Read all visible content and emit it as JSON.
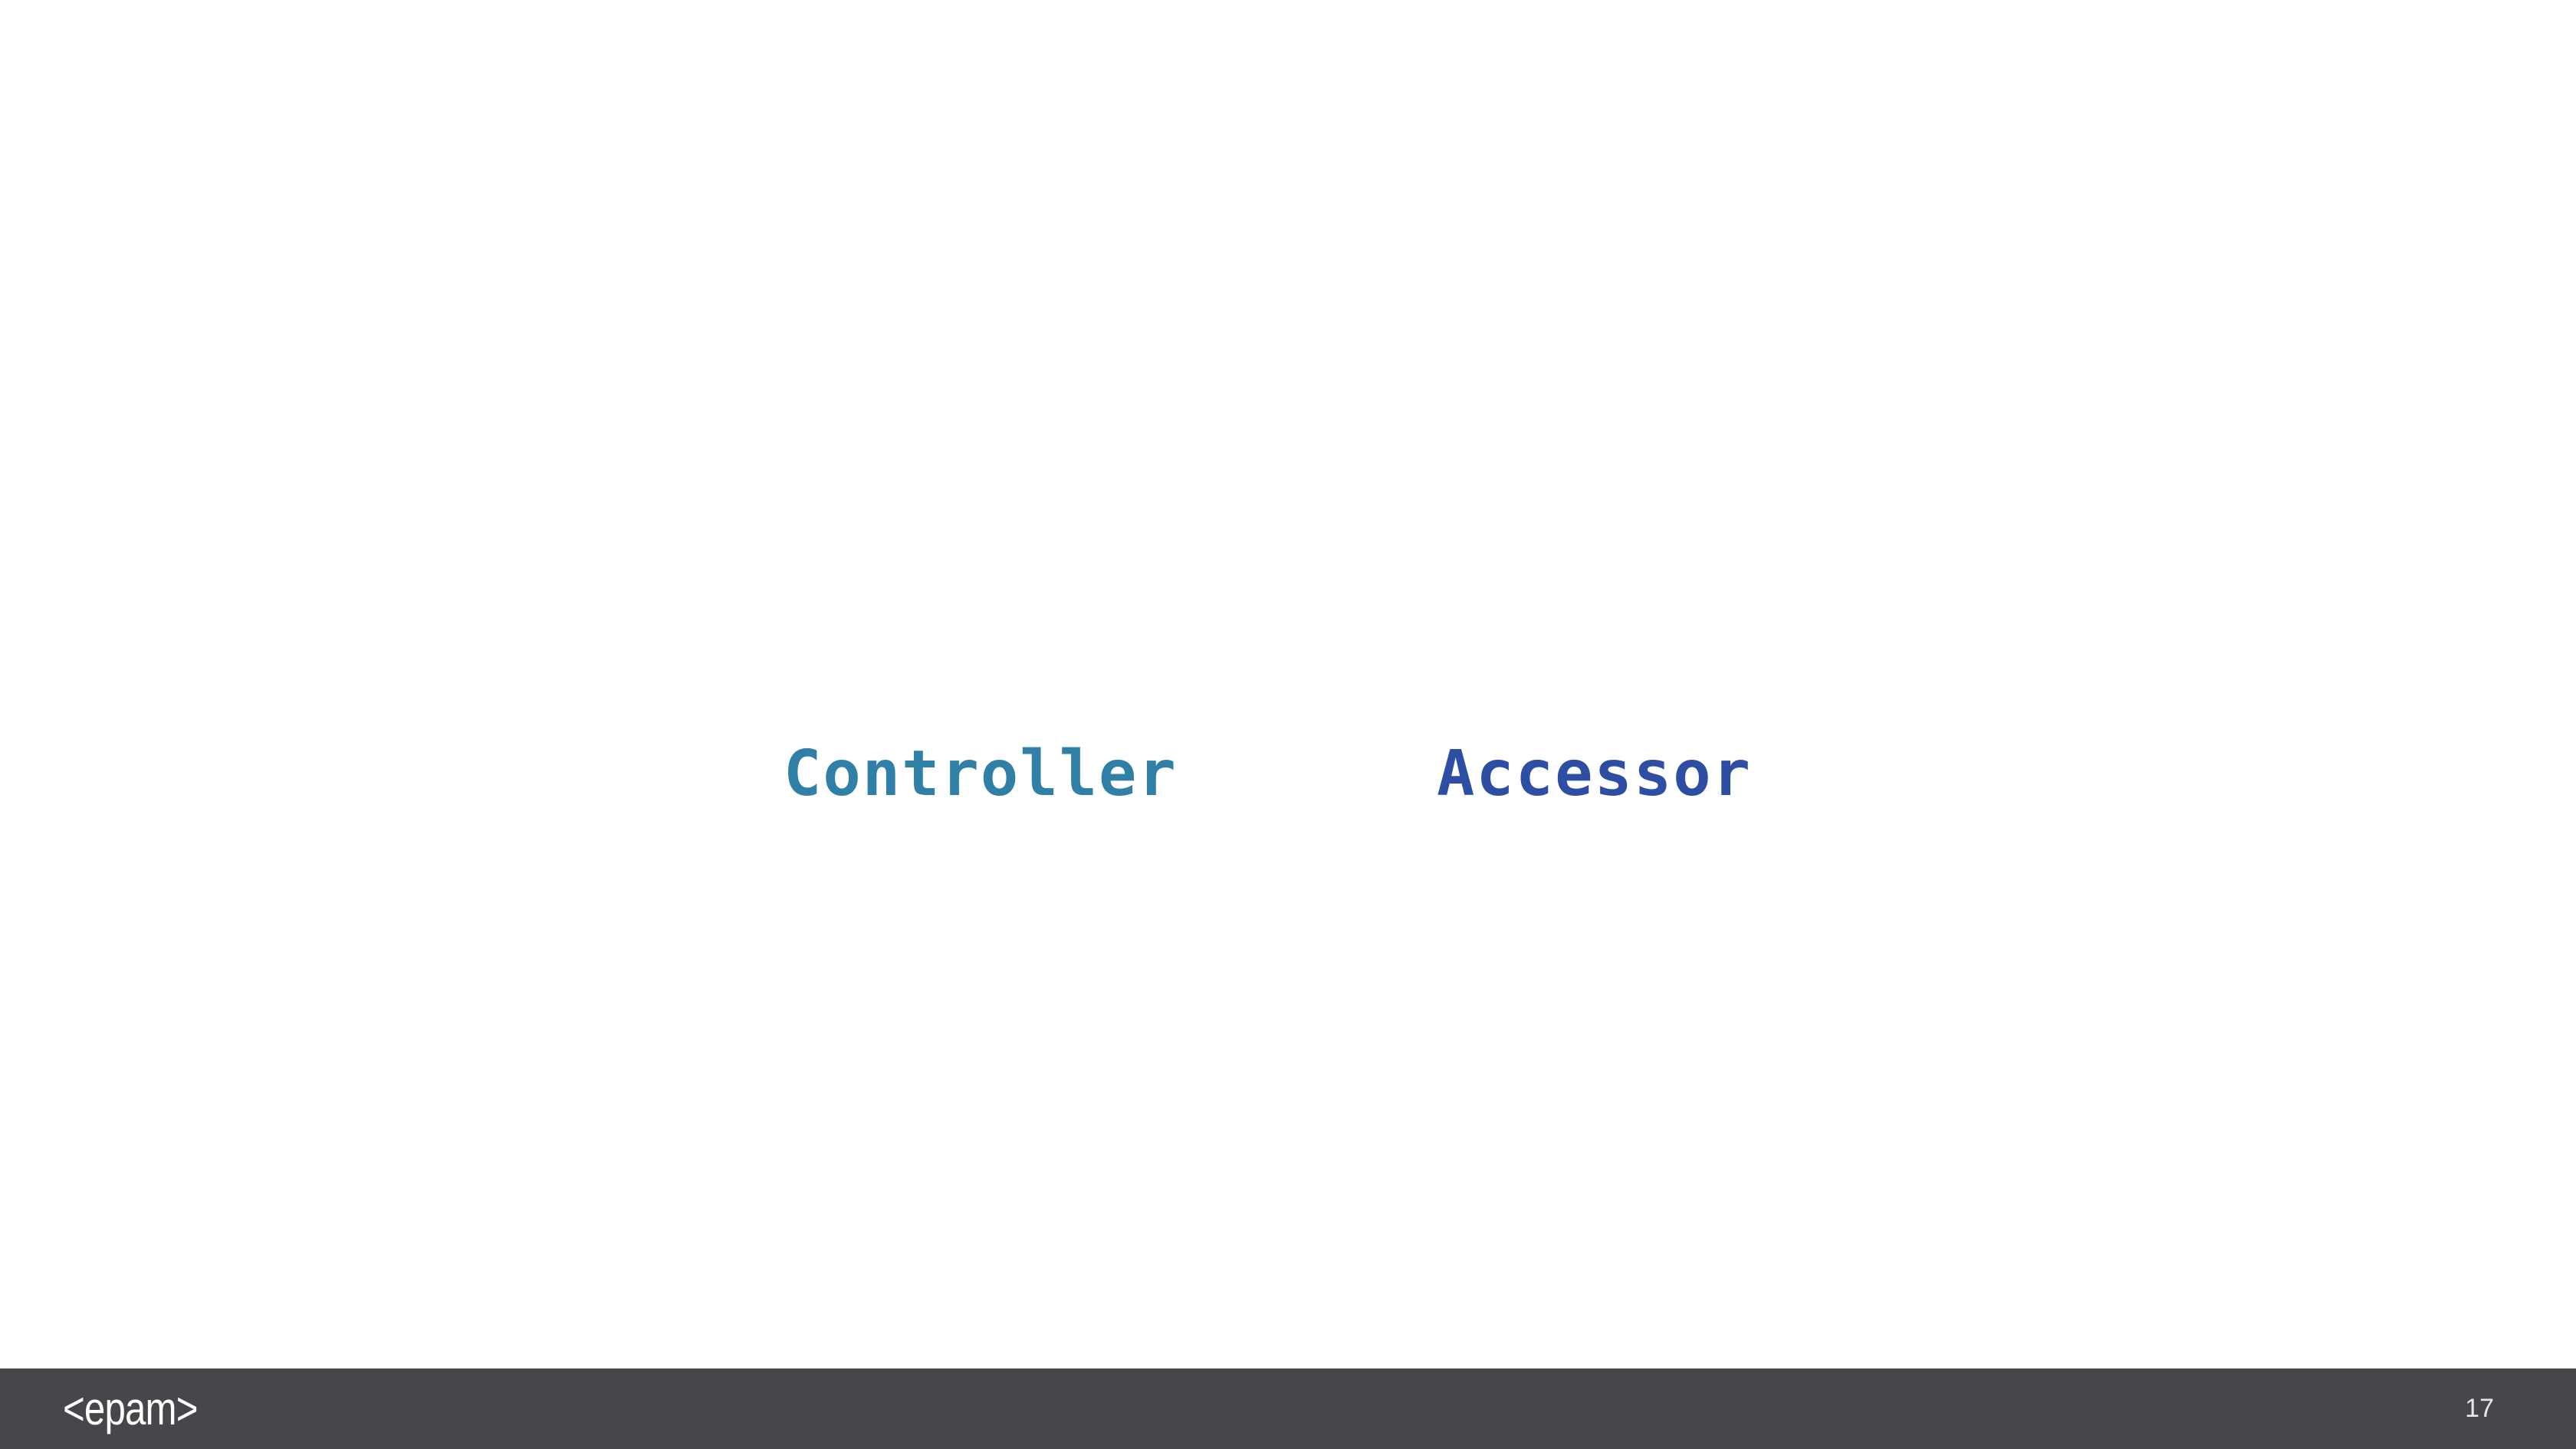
{
  "slide": {
    "words": [
      {
        "text": "Controller",
        "color": "#2f7fa6"
      },
      {
        "text": "Accessor",
        "color": "#2e4ea3"
      }
    ]
  },
  "footer": {
    "logo_text": "<epam>",
    "page_number": "17",
    "background_color": "#46474a"
  }
}
